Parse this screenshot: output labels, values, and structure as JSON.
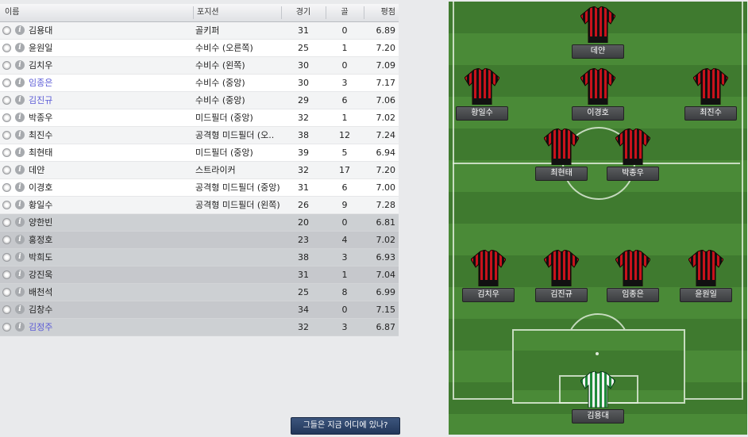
{
  "table": {
    "headers": {
      "name": "이름",
      "position": "포지션",
      "apps": "경기",
      "goals": "골",
      "rating": "평점"
    },
    "starters": [
      {
        "name": "김용대",
        "position": "골키퍼",
        "apps": "31",
        "goals": "0",
        "rating": "6.89"
      },
      {
        "name": "윤원일",
        "position": "수비수 (오른쪽)",
        "apps": "25",
        "goals": "1",
        "rating": "7.20"
      },
      {
        "name": "김치우",
        "position": "수비수 (왼쪽)",
        "apps": "30",
        "goals": "0",
        "rating": "7.09"
      },
      {
        "name": "임종은",
        "position": "수비수 (중앙)",
        "apps": "30",
        "goals": "3",
        "rating": "7.17",
        "link": true
      },
      {
        "name": "김진규",
        "position": "수비수 (중앙)",
        "apps": "29",
        "goals": "6",
        "rating": "7.06",
        "link": true
      },
      {
        "name": "박종우",
        "position": "미드필더 (중앙)",
        "apps": "32",
        "goals": "1",
        "rating": "7.02"
      },
      {
        "name": "최진수",
        "position": "공격형 미드필더 (오..",
        "apps": "38",
        "goals": "12",
        "rating": "7.24"
      },
      {
        "name": "최현태",
        "position": "미드필더 (중앙)",
        "apps": "39",
        "goals": "5",
        "rating": "6.94"
      },
      {
        "name": "데얀",
        "position": "스트라이커",
        "apps": "32",
        "goals": "17",
        "rating": "7.20"
      },
      {
        "name": "이경호",
        "position": "공격형 미드필더 (중앙)",
        "apps": "31",
        "goals": "6",
        "rating": "7.00"
      },
      {
        "name": "황일수",
        "position": "공격형 미드필더 (왼쪽)",
        "apps": "26",
        "goals": "9",
        "rating": "7.28"
      }
    ],
    "subs": [
      {
        "name": "양한빈",
        "position": "",
        "apps": "20",
        "goals": "0",
        "rating": "6.81"
      },
      {
        "name": "홍정호",
        "position": "",
        "apps": "23",
        "goals": "4",
        "rating": "7.02"
      },
      {
        "name": "박희도",
        "position": "",
        "apps": "38",
        "goals": "3",
        "rating": "6.93"
      },
      {
        "name": "강진욱",
        "position": "",
        "apps": "31",
        "goals": "1",
        "rating": "7.04"
      },
      {
        "name": "배천석",
        "position": "",
        "apps": "25",
        "goals": "8",
        "rating": "6.99"
      },
      {
        "name": "김창수",
        "position": "",
        "apps": "34",
        "goals": "0",
        "rating": "7.15"
      },
      {
        "name": "김정주",
        "position": "",
        "apps": "32",
        "goals": "3",
        "rating": "6.87",
        "link": true
      }
    ]
  },
  "button": {
    "label": "그들은 지금 어디에 있나?"
  },
  "pitch": {
    "players": [
      {
        "name": "데얀",
        "role": "striker",
        "kit": "red-black"
      },
      {
        "name": "황일수",
        "role": "left-am",
        "kit": "red-black"
      },
      {
        "name": "이경호",
        "role": "center-am",
        "kit": "red-black"
      },
      {
        "name": "최진수",
        "role": "right-am",
        "kit": "red-black"
      },
      {
        "name": "최현태",
        "role": "center-mid-left",
        "kit": "red-black"
      },
      {
        "name": "박종우",
        "role": "center-mid-right",
        "kit": "red-black"
      },
      {
        "name": "김치우",
        "role": "left-back",
        "kit": "red-black"
      },
      {
        "name": "김진규",
        "role": "center-back-left",
        "kit": "red-black"
      },
      {
        "name": "임종은",
        "role": "center-back-right",
        "kit": "red-black"
      },
      {
        "name": "윤원일",
        "role": "right-back",
        "kit": "red-black"
      },
      {
        "name": "김용대",
        "role": "goalkeeper",
        "kit": "green-white"
      }
    ]
  },
  "colors": {
    "link": "#5b5bd6",
    "kit_red": "#c8121b",
    "kit_black": "#111111",
    "gk_green": "#1e8a3a",
    "pitch": "#3f7a2f"
  }
}
